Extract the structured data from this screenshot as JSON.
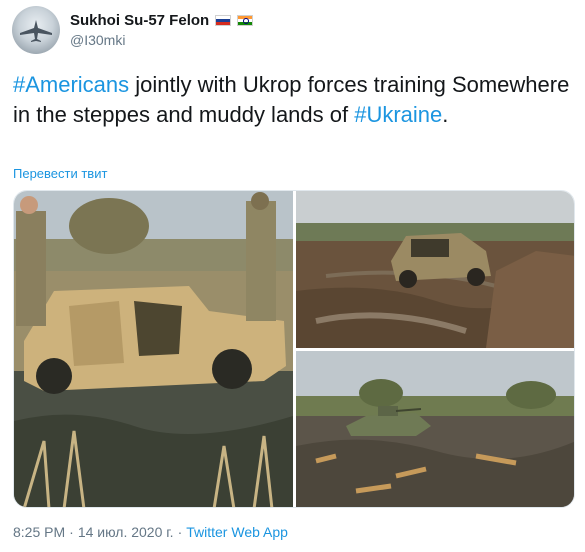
{
  "author": {
    "display_name": "Sukhoi Su-57 Felon",
    "handle": "@I30mki",
    "flags": [
      "russia-flag-icon",
      "india-flag-icon"
    ]
  },
  "tweet": {
    "hashtag1": "#Americans",
    "text1": " jointly with Ukrop forces training Somewhere in the steppes and muddy lands of ",
    "hashtag2": "#Ukraine",
    "text2": "."
  },
  "translate_label": "Перевести твит",
  "media": {
    "photos": [
      "humvee-in-swamp-photo",
      "humvee-in-mud-field-photo",
      "bmp-in-swamp-photo"
    ]
  },
  "footer": {
    "time": "8:25 PM",
    "separator": "·",
    "date": "14 июл. 2020 г.",
    "separator2": "·",
    "source": "Twitter Web App"
  },
  "colors": {
    "link": "#1b95e0",
    "text": "#14171a",
    "secondary": "#657786"
  }
}
